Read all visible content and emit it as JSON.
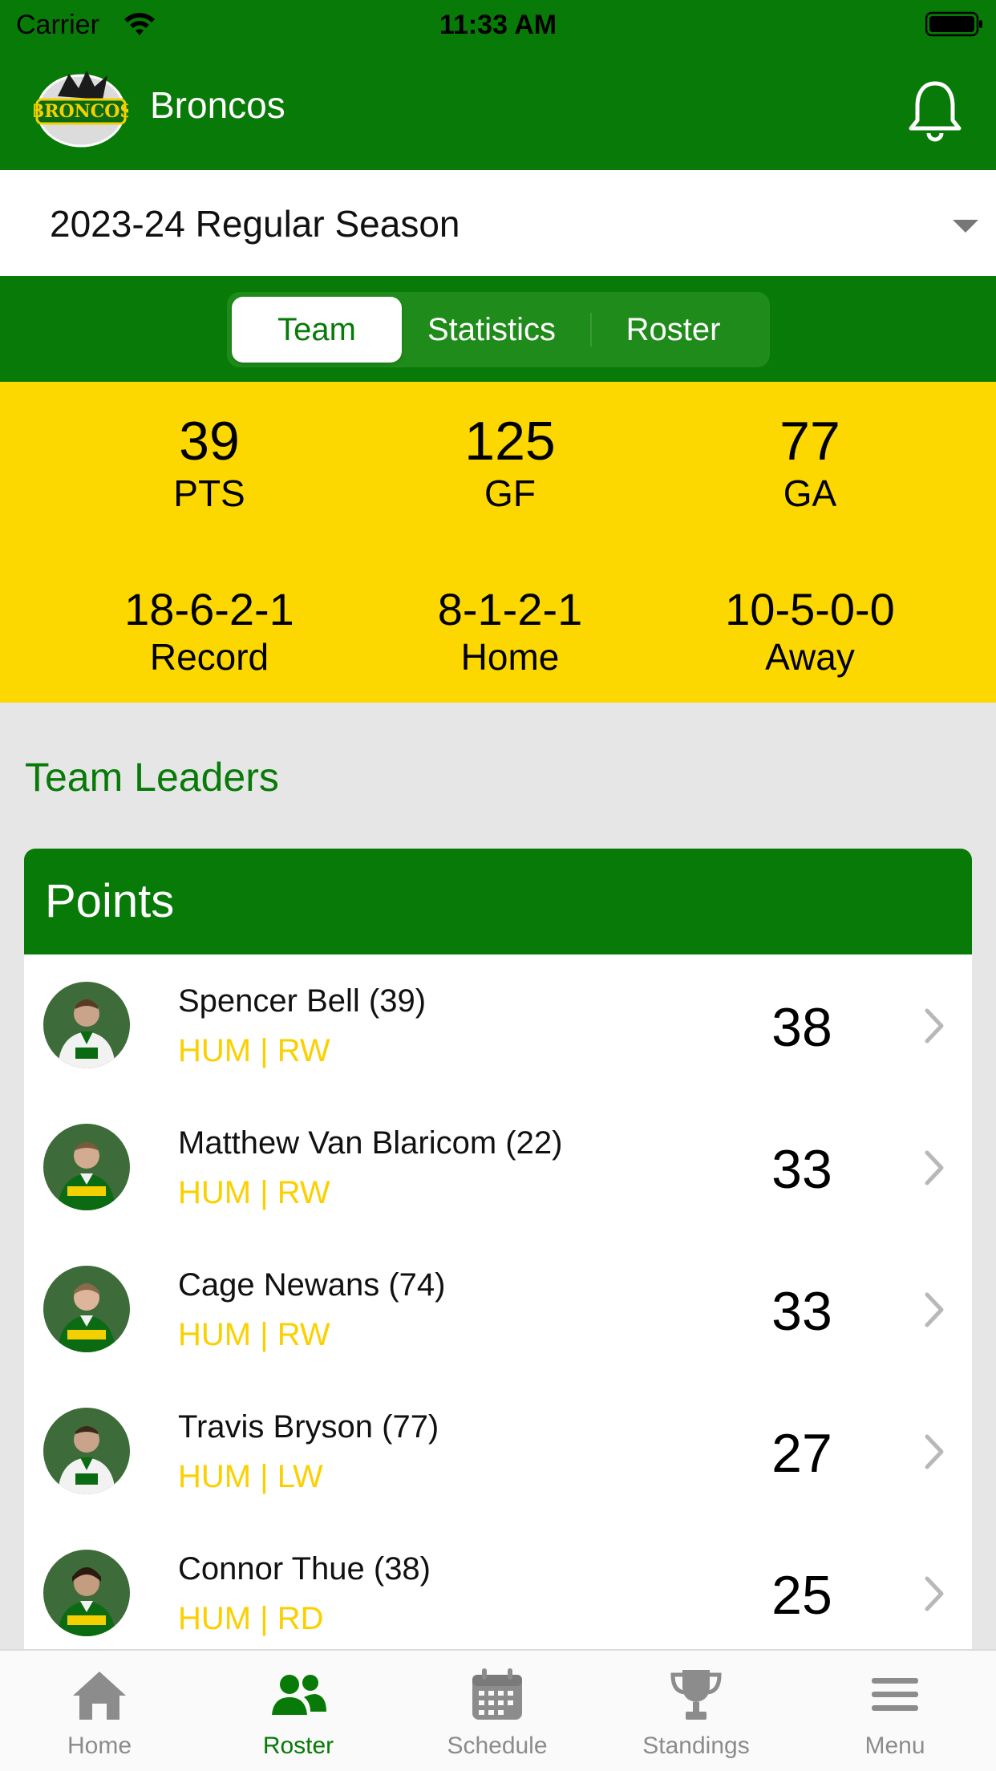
{
  "status_bar": {
    "carrier": "Carrier",
    "time": "11:33 AM"
  },
  "header": {
    "team_name": "Broncos",
    "logo_icon": "broncos-logo-icon",
    "bell_icon": "bell-icon"
  },
  "season": {
    "selected": "2023-24 Regular Season"
  },
  "tabs": [
    {
      "label": "Team",
      "active": true
    },
    {
      "label": "Statistics",
      "active": false
    },
    {
      "label": "Roster",
      "active": false
    }
  ],
  "stats": [
    {
      "value": "39",
      "label": "PTS"
    },
    {
      "value": "125",
      "label": "GF"
    },
    {
      "value": "77",
      "label": "GA"
    },
    {
      "value": "18-6-2-1",
      "label": "Record"
    },
    {
      "value": "8-1-2-1",
      "label": "Home"
    },
    {
      "value": "10-5-0-0",
      "label": "Away"
    }
  ],
  "leaders": {
    "title": "Team Leaders",
    "card_title": "Points",
    "players": [
      {
        "name": "Spencer Bell (39)",
        "info": "HUM | RW",
        "value": "38"
      },
      {
        "name": "Matthew Van Blaricom (22)",
        "info": "HUM | RW",
        "value": "33"
      },
      {
        "name": "Cage Newans (74)",
        "info": "HUM | RW",
        "value": "33"
      },
      {
        "name": "Travis Bryson (77)",
        "info": "HUM | LW",
        "value": "27"
      },
      {
        "name": "Connor Thue (38)",
        "info": "HUM | RD",
        "value": "25"
      }
    ]
  },
  "tabbar": [
    {
      "label": "Home",
      "icon": "home-icon"
    },
    {
      "label": "Roster",
      "icon": "roster-icon",
      "active": true
    },
    {
      "label": "Schedule",
      "icon": "calendar-icon"
    },
    {
      "label": "Standings",
      "icon": "trophy-icon"
    },
    {
      "label": "Menu",
      "icon": "menu-icon"
    }
  ],
  "colors": {
    "brand_green": "#077a07",
    "accent_yellow": "#fcd800"
  }
}
